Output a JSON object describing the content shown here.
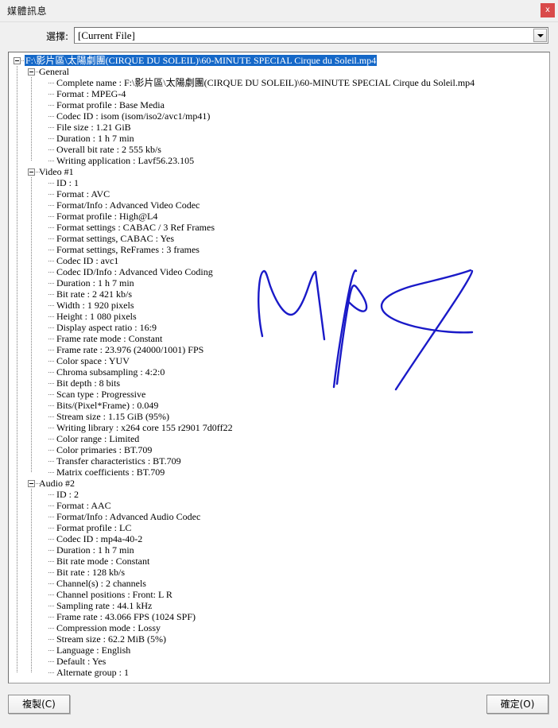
{
  "window": {
    "title": "媒體訊息",
    "close_label": "x"
  },
  "selector": {
    "label": "選擇:",
    "value": "[Current File]",
    "arrow_icon": "chevron-down-icon"
  },
  "tree": {
    "root": {
      "label": "F:\\影片區\\太陽劇團(CIRQUE DU SOLEIL)\\60-MINUTE SPECIAL  Cirque du Soleil.mp4",
      "selected": true
    },
    "sections": [
      {
        "name": "General",
        "items": [
          "Complete name : F:\\影片區\\太陽劇團(CIRQUE DU SOLEIL)\\60-MINUTE SPECIAL  Cirque du Soleil.mp4",
          "Format : MPEG-4",
          "Format profile : Base Media",
          "Codec ID : isom (isom/iso2/avc1/mp41)",
          "File size : 1.21 GiB",
          "Duration : 1 h 7 min",
          "Overall bit rate : 2 555 kb/s",
          "Writing application : Lavf56.23.105"
        ]
      },
      {
        "name": "Video #1",
        "items": [
          "ID : 1",
          "Format : AVC",
          "Format/Info : Advanced Video Codec",
          "Format profile : High@L4",
          "Format settings : CABAC / 3 Ref Frames",
          "Format settings, CABAC : Yes",
          "Format settings, ReFrames : 3 frames",
          "Codec ID : avc1",
          "Codec ID/Info : Advanced Video Coding",
          "Duration : 1 h 7 min",
          "Bit rate : 2 421 kb/s",
          "Width : 1 920 pixels",
          "Height : 1 080 pixels",
          "Display aspect ratio : 16:9",
          "Frame rate mode : Constant",
          "Frame rate : 23.976 (24000/1001) FPS",
          "Color space : YUV",
          "Chroma subsampling : 4:2:0",
          "Bit depth : 8 bits",
          "Scan type : Progressive",
          "Bits/(Pixel*Frame) : 0.049",
          "Stream size : 1.15 GiB (95%)",
          "Writing library : x264 core 155 r2901 7d0ff22",
          "Color range : Limited",
          "Color primaries : BT.709",
          "Transfer characteristics : BT.709",
          "Matrix coefficients : BT.709"
        ]
      },
      {
        "name": "Audio #2",
        "items": [
          "ID : 2",
          "Format : AAC",
          "Format/Info : Advanced Audio Codec",
          "Format profile : LC",
          "Codec ID : mp4a-40-2",
          "Duration : 1 h 7 min",
          "Bit rate mode : Constant",
          "Bit rate : 128 kb/s",
          "Channel(s) : 2 channels",
          "Channel positions : Front: L R",
          "Sampling rate : 44.1 kHz",
          "Frame rate : 43.066 FPS (1024 SPF)",
          "Compression mode : Lossy",
          "Stream size : 62.2 MiB (5%)",
          "Language : English",
          "Default : Yes",
          "Alternate group : 1"
        ]
      }
    ]
  },
  "annotation": {
    "text": "MP4",
    "color": "#1a1ac8",
    "kind": "handwritten-ink"
  },
  "footer": {
    "copy_label": "複製(C)",
    "ok_label": "確定(O)"
  },
  "colors": {
    "selection_blue": "#1568c8",
    "close_red": "#d94a4a",
    "window_bg": "#f0f0f0",
    "panel_bg": "#ffffff"
  }
}
